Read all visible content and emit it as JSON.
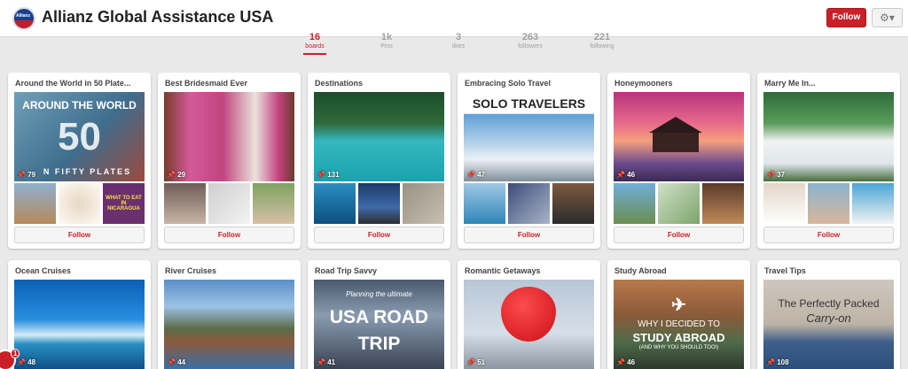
{
  "header": {
    "profile_name": "Allianz Global Assistance USA",
    "logo_text": "Allianz",
    "follow_label": "Follow",
    "settings_icon": "gear-icon"
  },
  "stats": [
    {
      "value": "16",
      "label": "boards",
      "active": true
    },
    {
      "value": "1k",
      "label": "Pins",
      "active": false
    },
    {
      "value": "3",
      "label": "likes",
      "active": false
    },
    {
      "value": "263",
      "label": "followers",
      "active": false
    },
    {
      "value": "221",
      "label": "following",
      "active": false
    }
  ],
  "boards": [
    {
      "title": "Around the World in 50 Plate...",
      "pins": "79",
      "cover_text": "AROUND THE WORLD",
      "cover_caption": "N FIFTY PLATES",
      "follow_label": "Follow",
      "thumb_text": "WHAT TO EAT IN NICARAGUA"
    },
    {
      "title": "Best Bridesmaid Ever",
      "pins": "29",
      "follow_label": "Follow"
    },
    {
      "title": "Destinations",
      "pins": "131",
      "follow_label": "Follow"
    },
    {
      "title": "Embracing Solo Travel",
      "pins": "47",
      "cover_text": "SOLO TRAVELERS",
      "follow_label": "Follow"
    },
    {
      "title": "Honeymooners",
      "pins": "46",
      "follow_label": "Follow"
    },
    {
      "title": "Marry Me In...",
      "pins": "37",
      "follow_label": "Follow"
    },
    {
      "title": "Ocean Cruises",
      "pins": "48"
    },
    {
      "title": "River Cruises",
      "pins": "44"
    },
    {
      "title": "Road Trip Savvy",
      "pins": "41",
      "cover_text": "USA ROAD TRIP",
      "cover_caption": "Planning the ultimate"
    },
    {
      "title": "Romantic Getaways",
      "pins": "51"
    },
    {
      "title": "Study Abroad",
      "pins": "46",
      "cover_caption": "WHY I DECIDED TO",
      "cover_text": "STUDY ABROAD",
      "cover_sub": "(AND WHY YOU SHOULD TOO!)"
    },
    {
      "title": "Travel Tips",
      "pins": "108",
      "cover_text": "The Perfectly Packed",
      "cover_caption": "Carry-on"
    }
  ],
  "notification_count": "1",
  "colors": {
    "accent": "#cb2027"
  }
}
